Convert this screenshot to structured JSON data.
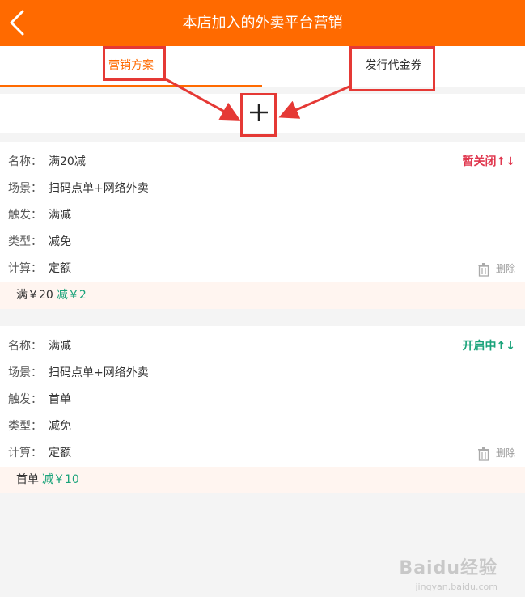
{
  "header": {
    "title": "本店加入的外卖平台营销"
  },
  "tabs": [
    {
      "label": "营销方案",
      "active": true
    },
    {
      "label": "发行代金券",
      "active": false
    }
  ],
  "add": {
    "icon": "plus-icon"
  },
  "cards": [
    {
      "fields": [
        {
          "label": "名称：",
          "value": "满20减"
        },
        {
          "label": "场景：",
          "value": "扫码点单+网络外卖"
        },
        {
          "label": "触发：",
          "value": "满减"
        },
        {
          "label": "类型：",
          "value": "减免"
        },
        {
          "label": "计算：",
          "value": "定额"
        }
      ],
      "status": "暂关闭↑↓",
      "delete_label": "删除",
      "summary_a": "满￥20",
      "summary_b": "减￥2"
    },
    {
      "fields": [
        {
          "label": "名称：",
          "value": "满减"
        },
        {
          "label": "场景：",
          "value": "扫码点单+网络外卖"
        },
        {
          "label": "触发：",
          "value": "首单"
        },
        {
          "label": "类型：",
          "value": "减免"
        },
        {
          "label": "计算：",
          "value": "定额"
        }
      ],
      "status": "开启中↑↓",
      "delete_label": "删除",
      "summary_a": "首单",
      "summary_b": "减￥10"
    }
  ],
  "watermark": {
    "brand": "Baidu经验",
    "url": "jingyan.baidu.com"
  },
  "colors": {
    "accent": "#ff6a00",
    "closed": "#e0384f",
    "open": "#1aa37a",
    "annotation": "#e53935"
  }
}
